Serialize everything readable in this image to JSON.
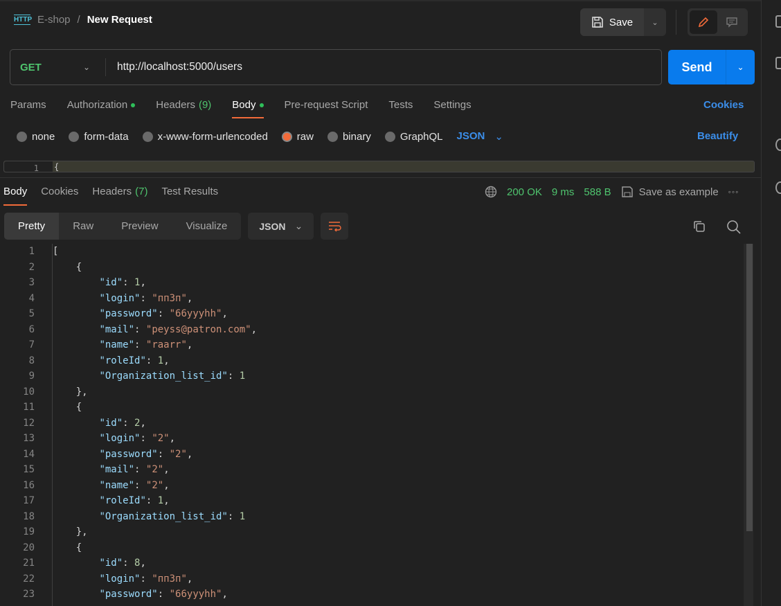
{
  "breadcrumb": {
    "icon": "http-icon",
    "icon_text": "HTTP",
    "collection": "E-shop",
    "separator": "/",
    "title": "New Request"
  },
  "header": {
    "save_label": "Save"
  },
  "request": {
    "method": "GET",
    "url": "http://localhost:5000/users",
    "send_label": "Send"
  },
  "request_tabs": [
    {
      "label": "Params"
    },
    {
      "label": "Authorization",
      "dot": true
    },
    {
      "label": "Headers",
      "count": "(9)"
    },
    {
      "label": "Body",
      "dot": true,
      "active": true
    },
    {
      "label": "Pre-request Script"
    },
    {
      "label": "Tests"
    },
    {
      "label": "Settings"
    }
  ],
  "cookies_label": "Cookies",
  "body_options": [
    {
      "label": "none"
    },
    {
      "label": "form-data"
    },
    {
      "label": "x-www-form-urlencoded"
    },
    {
      "label": "raw",
      "selected": true
    },
    {
      "label": "binary"
    },
    {
      "label": "GraphQL"
    }
  ],
  "body_format": "JSON",
  "beautify_label": "Beautify",
  "request_editor": {
    "line": "1",
    "text": "{"
  },
  "response_tabs": [
    {
      "label": "Body",
      "active": true
    },
    {
      "label": "Cookies"
    },
    {
      "label": "Headers",
      "count": "(7)"
    },
    {
      "label": "Test Results"
    }
  ],
  "response_status": {
    "status": "200 OK",
    "time": "9 ms",
    "size": "588 B",
    "save_example": "Save as example"
  },
  "view_modes": [
    "Pretty",
    "Raw",
    "Preview",
    "Visualize"
  ],
  "response_format": "JSON",
  "colors": {
    "accent": "#f26b3a",
    "send": "#097bed",
    "link": "#3b8eea",
    "success": "#4fc46e",
    "key": "#9cdcfe",
    "string": "#ce9178",
    "number": "#b5cea8"
  },
  "response_lines": [
    "[",
    "    {",
    "        \"id\": 1,",
    "        \"login\": \"пп3п\",",
    "        \"password\": \"66yyyhh\",",
    "        \"mail\": \"peyss@patron.com\",",
    "        \"name\": \"raarr\",",
    "        \"roleId\": 1,",
    "        \"Organization_list_id\": 1",
    "    },",
    "    {",
    "        \"id\": 2,",
    "        \"login\": \"2\",",
    "        \"password\": \"2\",",
    "        \"mail\": \"2\",",
    "        \"name\": \"2\",",
    "        \"roleId\": 1,",
    "        \"Organization_list_id\": 1",
    "    },",
    "    {",
    "        \"id\": 8,",
    "        \"login\": \"пп3п\",",
    "        \"password\": \"66yyyhh\","
  ]
}
